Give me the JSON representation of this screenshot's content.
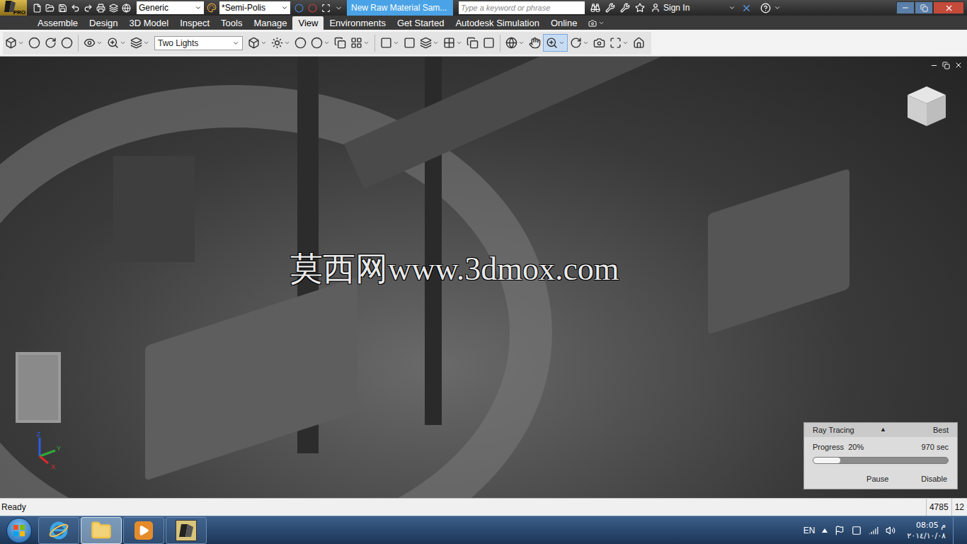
{
  "app": {
    "edition": "PRO"
  },
  "title_bar": {
    "appearance": "Generic",
    "material": "*Semi-Polis",
    "document_title": "New Raw Material Sam...",
    "search_placeholder": "Type a keyword or phrase",
    "sign_in": "Sign In"
  },
  "ribbon_tabs": [
    {
      "label": "Assemble",
      "selected": false
    },
    {
      "label": "Design",
      "selected": false
    },
    {
      "label": "3D Model",
      "selected": false
    },
    {
      "label": "Inspect",
      "selected": false
    },
    {
      "label": "Tools",
      "selected": false
    },
    {
      "label": "Manage",
      "selected": false
    },
    {
      "label": "View",
      "selected": true
    },
    {
      "label": "Environments",
      "selected": false
    },
    {
      "label": "Get Started",
      "selected": false
    },
    {
      "label": "Autodesk Simulation",
      "selected": false
    },
    {
      "label": "Online",
      "selected": false
    }
  ],
  "toolbar": {
    "lighting": "Two Lights"
  },
  "viewport": {
    "watermark": "莫西网www.3dmox.com",
    "axes": [
      "Z",
      "Y",
      "X"
    ]
  },
  "ray_tracing": {
    "title": "Ray Tracing",
    "toggle": "▲",
    "quality": "Best",
    "progress_label": "Progress",
    "progress": "20%",
    "time": "970 sec",
    "level": 0.2,
    "buttons": [
      "Pause",
      "Disable"
    ]
  },
  "status_bar": {
    "message": "Ready",
    "values": [
      "4785",
      "12"
    ]
  },
  "taskbar": {
    "apps": [
      {
        "kind": "ie",
        "selected": false
      },
      {
        "kind": "folder",
        "selected": true
      },
      {
        "kind": "media",
        "selected": false
      },
      {
        "kind": "inventor",
        "selected": false
      }
    ]
  },
  "tray": {
    "language": "EN",
    "time": "08:05 م",
    "date": "٢٠١٤/١٠/٠٨"
  }
}
